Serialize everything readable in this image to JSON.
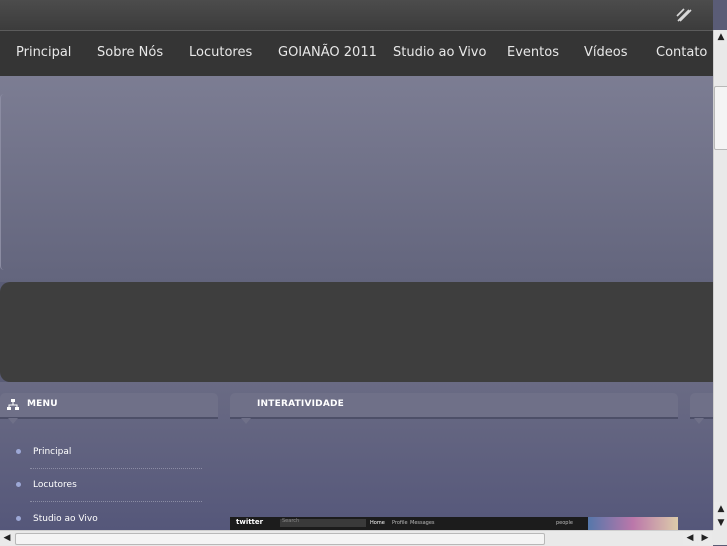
{
  "nav": {
    "items": [
      "Principal",
      "Sobre Nós",
      "Locutores",
      "GOIANÃO 2011",
      "Studio ao Vivo",
      "Eventos",
      "Vídeos",
      "Contato"
    ]
  },
  "tabs": {
    "menu": "MENU",
    "interatividade": "INTERATIVIDADE"
  },
  "menu": {
    "items": [
      "Principal",
      "Locutores",
      "Studio ao Vivo"
    ]
  },
  "twitter": {
    "logo": "twitter",
    "search_placeholder": "Search",
    "links": [
      "Home",
      "Profile",
      "Messages"
    ],
    "account": "people"
  },
  "icons": {
    "toolbar": "edit-tool-icon",
    "menu_tab": "sitemap-icon"
  },
  "colors": {
    "nav_bg": "#353535",
    "hero": "#6e6f87",
    "content": "#5a5c76",
    "accent_bullet": "#9da8d6"
  }
}
